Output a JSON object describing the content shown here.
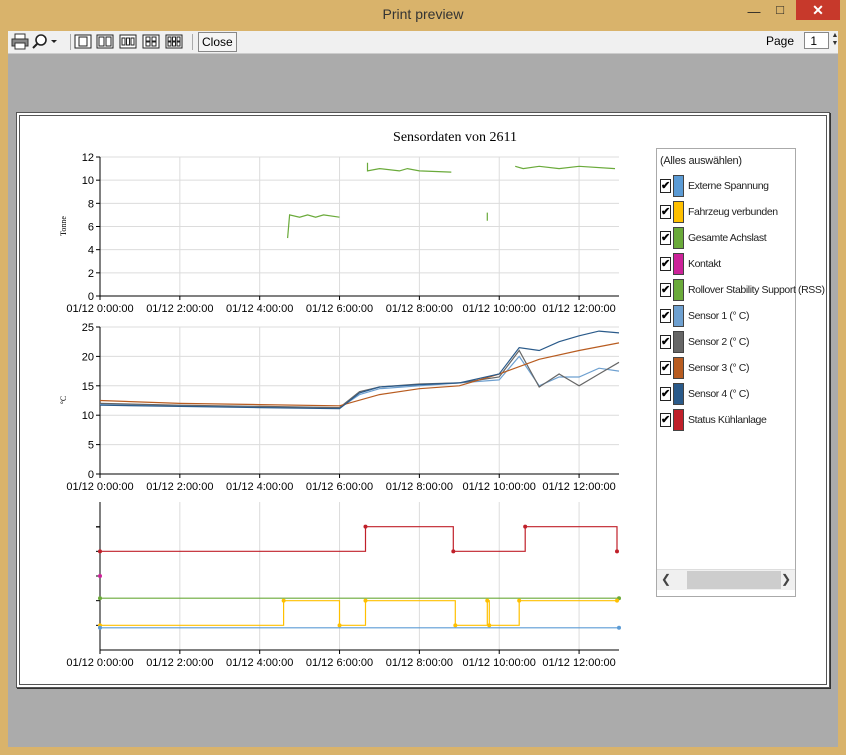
{
  "window": {
    "title": "Print preview"
  },
  "toolbar": {
    "close_label": "Close",
    "page_label": "Page",
    "page_value": "1",
    "icons": [
      "print-icon",
      "zoom-icon",
      "one-page-icon",
      "two-pages-icon",
      "three-pages-icon",
      "four-pages-icon",
      "six-pages-icon"
    ]
  },
  "chart": {
    "title": "Sensordaten von 2611"
  },
  "chart_data": [
    {
      "type": "line",
      "title": "Sensordaten von 2611",
      "ylabel": "Tonne",
      "ylim": [
        0,
        12
      ],
      "yticks": [
        "0",
        "2",
        "4",
        "6",
        "8",
        "10",
        "12"
      ],
      "xticks": [
        "01/12 0:00:00",
        "01/12 2:00:00",
        "01/12 4:00:00",
        "01/12 6:00:00",
        "01/12 8:00:00",
        "01/12 10:00:00",
        "01/12 12:00:00"
      ],
      "series": [
        {
          "name": "Gesamte Achslast",
          "color": "#6aaa3a",
          "x": [
            4.7,
            4.75,
            5.0,
            5.2,
            5.4,
            5.6,
            6.0,
            6.7,
            6.7,
            7.0,
            7.5,
            7.7,
            8.0,
            8.8,
            9.7,
            9.7,
            10.4,
            10.6,
            11.0,
            11.5,
            12.0,
            12.9
          ],
          "y": [
            5.0,
            7.0,
            6.8,
            7.0,
            6.8,
            7.0,
            6.8,
            11.5,
            10.8,
            11.0,
            10.8,
            11.0,
            10.8,
            10.7,
            6.5,
            7.2,
            11.2,
            11.0,
            11.2,
            11.0,
            11.2,
            11.0
          ]
        }
      ]
    },
    {
      "type": "line",
      "ylabel": "°C",
      "ylim": [
        0,
        25
      ],
      "yticks": [
        "0",
        "5",
        "10",
        "15",
        "20",
        "25"
      ],
      "xticks": [
        "01/12 0:00:00",
        "01/12 2:00:00",
        "01/12 4:00:00",
        "01/12 6:00:00",
        "01/12 8:00:00",
        "01/12 10:00:00",
        "01/12 12:00:00"
      ],
      "series": [
        {
          "name": "Sensor 1 (° C)",
          "color": "#6ea0d0",
          "x": [
            0,
            2,
            4,
            6,
            6.5,
            7,
            8,
            9,
            10,
            10.5,
            11,
            11.5,
            12,
            12.5,
            13
          ],
          "y": [
            11.8,
            11.6,
            11.4,
            11.2,
            13.5,
            14.5,
            15.0,
            15.5,
            16.0,
            20.0,
            15.0,
            16.5,
            16.5,
            18.0,
            17.5
          ]
        },
        {
          "name": "Sensor 2 (° C)",
          "color": "#666666",
          "x": [
            0,
            2,
            4,
            6,
            6.5,
            7,
            8,
            9,
            10,
            10.5,
            11,
            11.5,
            12,
            12.5,
            13
          ],
          "y": [
            12.0,
            11.7,
            11.5,
            11.3,
            14.0,
            14.8,
            15.3,
            15.5,
            16.5,
            21.0,
            14.8,
            17.0,
            15.0,
            17.0,
            19.0
          ]
        },
        {
          "name": "Sensor 3 (° C)",
          "color": "#b85c20",
          "x": [
            0,
            2,
            4,
            6,
            7,
            8,
            9,
            10,
            11,
            12,
            13
          ],
          "y": [
            12.5,
            12.0,
            11.8,
            11.6,
            13.5,
            14.5,
            15.0,
            17.0,
            19.5,
            21.0,
            22.3
          ]
        },
        {
          "name": "Sensor 4 (° C)",
          "color": "#2a5a8a",
          "x": [
            0,
            2,
            4,
            6,
            6.5,
            7,
            8,
            9,
            10,
            10.5,
            11,
            11.5,
            12,
            12.5,
            13
          ],
          "y": [
            11.7,
            11.5,
            11.3,
            11.1,
            13.8,
            14.8,
            15.2,
            15.5,
            17.0,
            21.5,
            21.0,
            22.5,
            23.5,
            24.3,
            24.0
          ]
        }
      ]
    },
    {
      "type": "line",
      "ylabel": "",
      "xticks": [
        "01/12 0:00:00",
        "01/12 2:00:00",
        "01/12 4:00:00",
        "01/12 6:00:00",
        "01/12 8:00:00",
        "01/12 10:00:00",
        "01/12 12:00:00"
      ],
      "series": [
        {
          "name": "Status Kühlanlage",
          "color": "#c0202a",
          "x": [
            0,
            6.65,
            6.65,
            8.85,
            8.85,
            10.65,
            10.65,
            12.95,
            12.95
          ],
          "y": [
            3.0,
            3.0,
            4.0,
            4.0,
            3.0,
            3.0,
            4.0,
            4.0,
            3.0
          ]
        },
        {
          "name": "Gesamte Achslast",
          "color": "#6aaa3a",
          "x": [
            0,
            13
          ],
          "y": [
            1.1,
            1.1
          ]
        },
        {
          "name": "Fahrzeug verbunden",
          "color": "#ffc000",
          "x": [
            0,
            4.6,
            4.6,
            6.0,
            6.0,
            6.65,
            6.65,
            8.9,
            8.9,
            9.7,
            9.7,
            9.75,
            9.75,
            10.5,
            10.5,
            12.95
          ],
          "y": [
            0.0,
            0.0,
            1.0,
            1.0,
            0.0,
            0.0,
            1.0,
            1.0,
            0.0,
            0.0,
            1.0,
            1.0,
            0.0,
            0.0,
            1.0,
            1.0
          ]
        },
        {
          "name": "Externe Spannung",
          "color": "#5b9bd5",
          "x": [
            0,
            13
          ],
          "y": [
            -0.1,
            -0.1
          ]
        },
        {
          "name": "Kontakt",
          "color": "#cc2299",
          "x": [
            0
          ],
          "y": [
            2.0
          ]
        }
      ]
    }
  ],
  "legend": {
    "title": "(Alles auswählen)",
    "items": [
      {
        "label": "Externe Spannung",
        "color": "#5b9bd5",
        "checked": "✔"
      },
      {
        "label": "Fahrzeug verbunden",
        "color": "#ffc000",
        "checked": "✔"
      },
      {
        "label": "Gesamte Achslast",
        "color": "#6aaa3a",
        "checked": "✔"
      },
      {
        "label": "Kontakt",
        "color": "#cc2299",
        "checked": "✔"
      },
      {
        "label": "Rollover Stability Support (RSS)",
        "color": "#6aaa3a",
        "checked": "✔"
      },
      {
        "label": "Sensor 1 (° C)",
        "color": "#6ea0d0",
        "checked": "✔"
      },
      {
        "label": "Sensor 2 (° C)",
        "color": "#666666",
        "checked": "✔"
      },
      {
        "label": "Sensor 3 (° C)",
        "color": "#b85c20",
        "checked": "✔"
      },
      {
        "label": "Sensor 4 (° C)",
        "color": "#2a5a8a",
        "checked": "✔"
      },
      {
        "label": "Status Kühlanlage",
        "color": "#c0202a",
        "checked": "✔"
      }
    ]
  }
}
